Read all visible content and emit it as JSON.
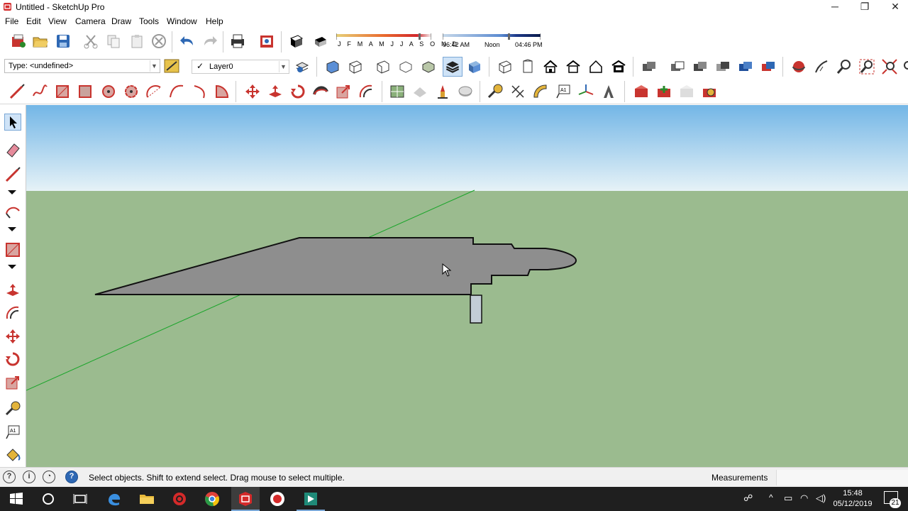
{
  "window": {
    "title": "Untitled - SketchUp Pro",
    "minimize": "─",
    "restore": "❐",
    "close": "✕"
  },
  "menu": [
    "File",
    "Edit",
    "View",
    "Camera",
    "Draw",
    "Tools",
    "Window",
    "Help"
  ],
  "entity_type": {
    "value": "Type: <undefined>"
  },
  "layer": {
    "value": "Layer0",
    "checked": "✓"
  },
  "shadow": {
    "months": "J F M A M J J A S O N D",
    "sunrise": "06:42 AM",
    "noon": "Noon",
    "sunset": "04:46 PM"
  },
  "status": {
    "message": "Select objects. Shift to extend select. Drag mouse to select multiple.",
    "measurements_label": "Measurements",
    "measurements_value": ""
  },
  "taskbar": {
    "time": "15:48",
    "date": "05/12/2019",
    "notifications": "21"
  },
  "colors": {
    "sky_top": "#73b6e6",
    "sky_bottom": "#e6f2f7",
    "ground": "#9bbb8f",
    "face": "#8e8e8e",
    "axis_green": "#1aa52a",
    "taskbar": "#1f1f1f"
  }
}
